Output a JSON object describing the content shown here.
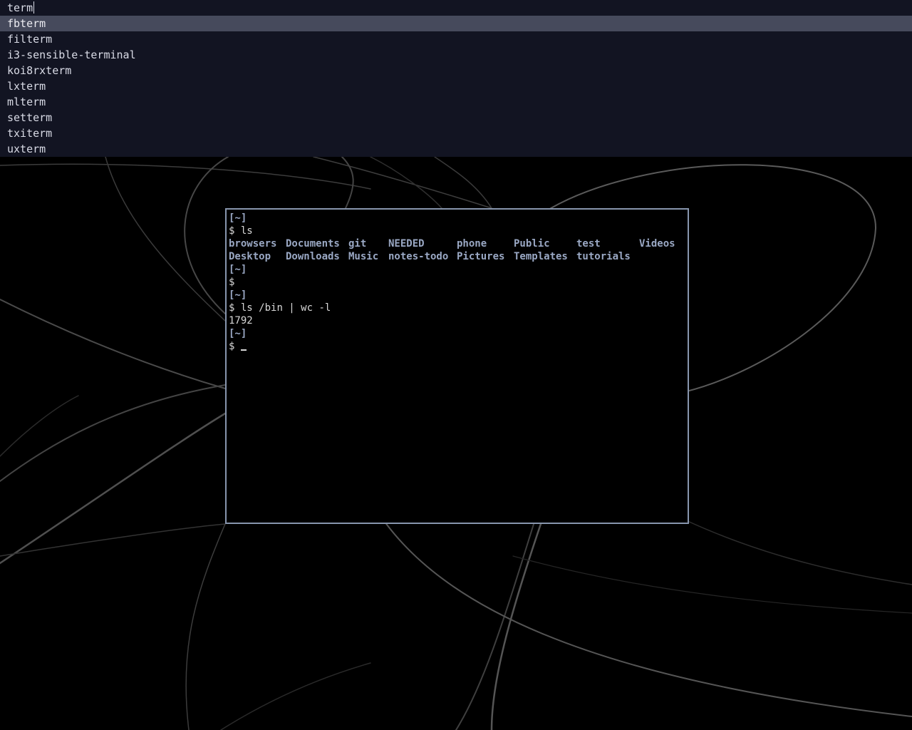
{
  "launcher": {
    "query": "term",
    "results": [
      {
        "label": "fbterm",
        "selected": true
      },
      {
        "label": "filterm",
        "selected": false
      },
      {
        "label": "i3-sensible-terminal",
        "selected": false
      },
      {
        "label": "koi8rxterm",
        "selected": false
      },
      {
        "label": "lxterm",
        "selected": false
      },
      {
        "label": "mlterm",
        "selected": false
      },
      {
        "label": "setterm",
        "selected": false
      },
      {
        "label": "txiterm",
        "selected": false
      },
      {
        "label": "uxterm",
        "selected": false
      }
    ]
  },
  "terminal": {
    "cwd_label": "[~]",
    "prompt": "$",
    "cmd1": "ls",
    "ls_row1": [
      "browsers",
      "Documents",
      "git",
      "NEEDED",
      "phone",
      "Public",
      "test",
      "Videos"
    ],
    "ls_row2": [
      "Desktop",
      "Downloads",
      "Music",
      "notes-todo",
      "Pictures",
      "Templates",
      "tutorials"
    ],
    "cmd2": "",
    "cmd3": "ls /bin | wc -l",
    "output3": "1792"
  },
  "colors": {
    "launcher_bg": "#121422",
    "launcher_selected": "#464a5c",
    "terminal_border": "#8795ad",
    "directory": "#9aa8c4"
  }
}
